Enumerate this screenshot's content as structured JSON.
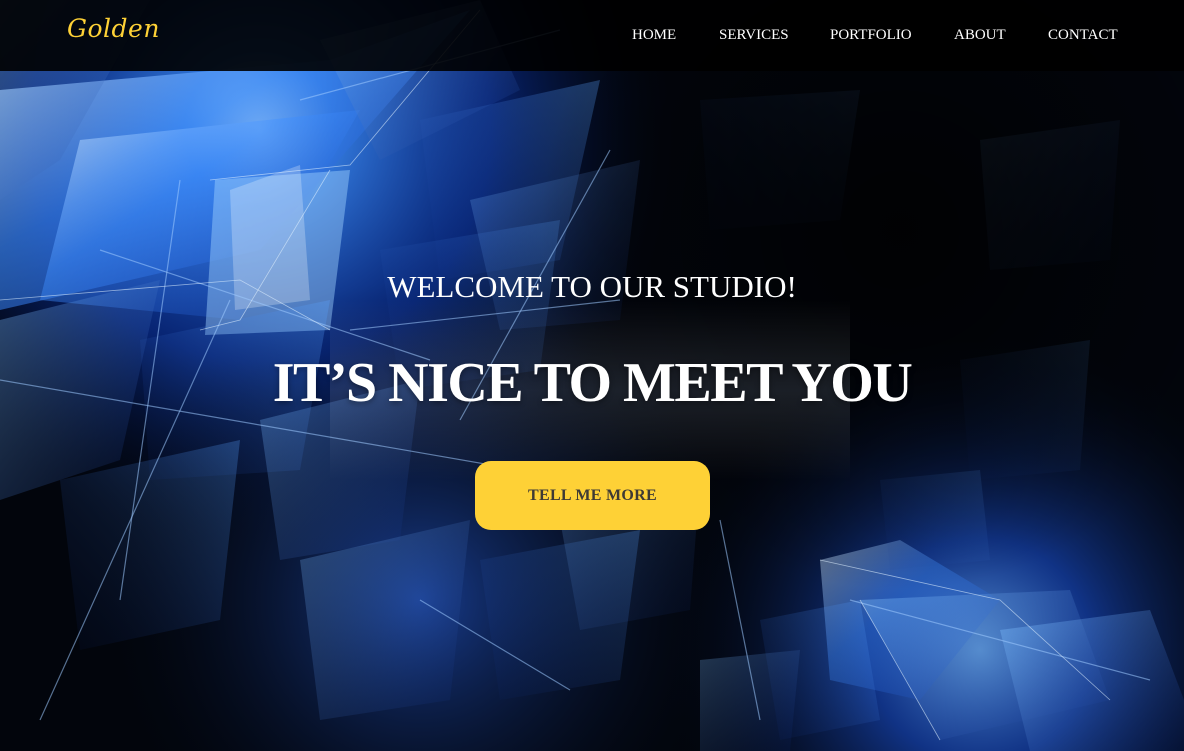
{
  "navbar": {
    "brand": "Golden",
    "links": [
      "HOME",
      "SERVICES",
      "PORTFOLIO",
      "ABOUT",
      "CONTACT"
    ]
  },
  "hero": {
    "lead": "WELCOME TO OUR STUDIO!",
    "heading": "IT’S NICE TO MEET YOU",
    "cta_label": "TELL ME MORE",
    "background_image": "abstract-blue-fractal-glass"
  },
  "colors": {
    "brand_accent": "#fed136",
    "nav_background": "#000000",
    "hero_dark": "#03060d",
    "hero_blue": "#1a5cff",
    "text": "#ffffff",
    "button_text": "#3e3a35"
  }
}
